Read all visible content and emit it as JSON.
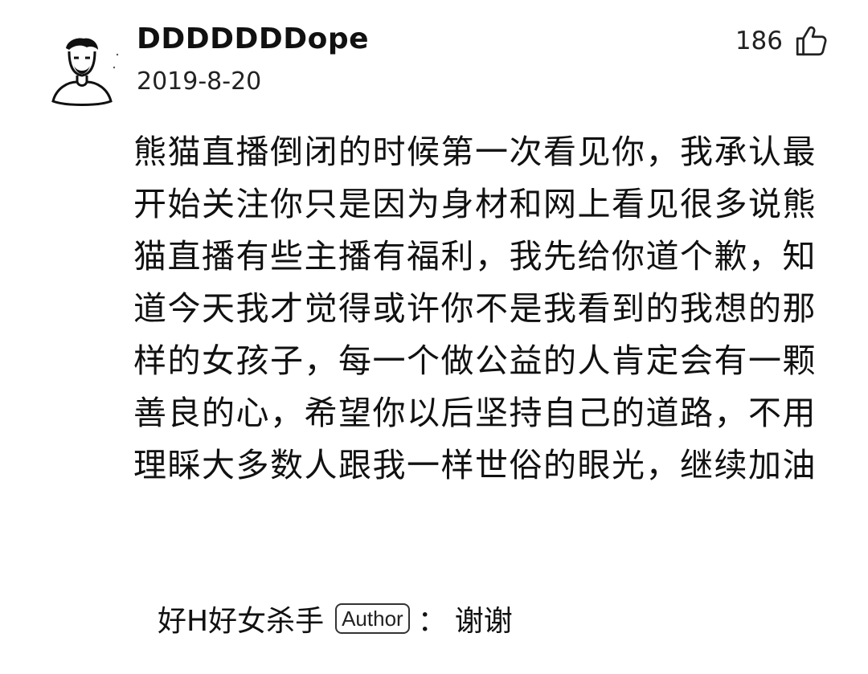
{
  "comment": {
    "username": "DDDDDDDope",
    "date": "2019-8-20",
    "like_count": "186",
    "like_icon": "thumb-up-icon",
    "avatar_icon": "avatar-sketch-icon",
    "text": "熊猫直播倒闭的时候第一次看见你，我承认最开始关注你只是因为身材和网上看见很多说熊猫直播有些主播有福利，我先给你道个歉，知道今天我才觉得或许你不是我看到的我想的那样的女孩子，每一个做公益的人肯定会有一颗善良的心，希望你以后坚持自己的道路，不用理睬大多数人跟我一样世俗的眼光，继续加油"
  },
  "reply": {
    "username": "好H好女杀手",
    "badge": "Author",
    "separator": "：",
    "text": "谢谢"
  }
}
